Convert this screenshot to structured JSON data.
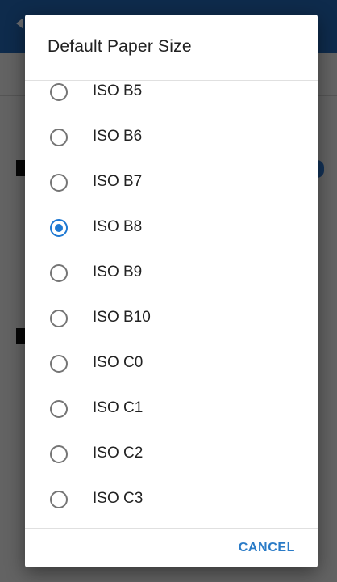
{
  "dialog": {
    "title": "Default Paper Size",
    "options": [
      {
        "label": "ISO B5",
        "selected": false
      },
      {
        "label": "ISO B6",
        "selected": false
      },
      {
        "label": "ISO B7",
        "selected": false
      },
      {
        "label": "ISO B8",
        "selected": true
      },
      {
        "label": "ISO B9",
        "selected": false
      },
      {
        "label": "ISO B10",
        "selected": false
      },
      {
        "label": "ISO C0",
        "selected": false
      },
      {
        "label": "ISO C1",
        "selected": false
      },
      {
        "label": "ISO C2",
        "selected": false
      },
      {
        "label": "ISO C3",
        "selected": false
      }
    ],
    "cancel_label": "CANCEL"
  },
  "colors": {
    "accent": "#1e78d2",
    "app_bar": "#1f5fa8",
    "cancel_text": "#2a7bc7"
  },
  "icons": {
    "back": "back-arrow-icon",
    "radio_unchecked": "radio-unchecked-icon",
    "radio_checked": "radio-checked-icon"
  }
}
